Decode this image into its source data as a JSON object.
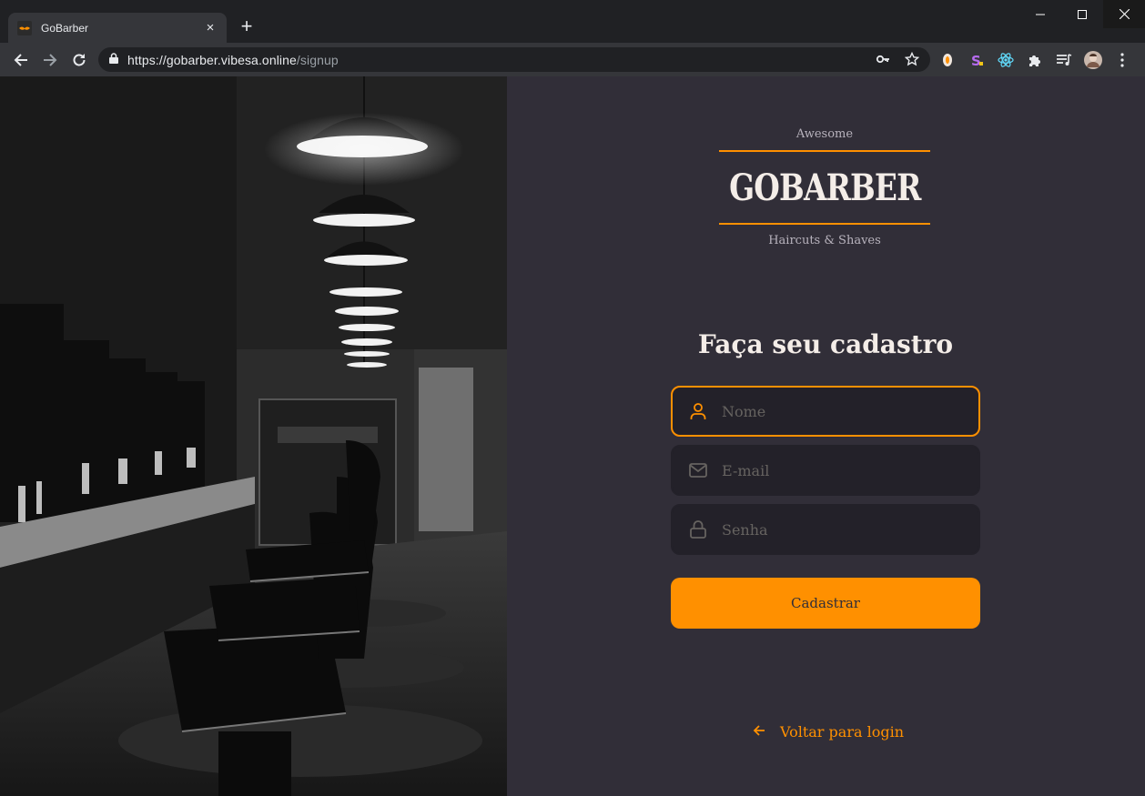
{
  "browser": {
    "tab_title": "GoBarber",
    "tab_close": "×",
    "new_tab": "+",
    "url_host": "https://gobarber.vibesa.online",
    "url_path": "/signup"
  },
  "logo": {
    "top": "Awesome",
    "main": "GOBARBER",
    "bottom": "Haircuts & Shaves"
  },
  "form": {
    "heading": "Faça seu cadastro",
    "name_placeholder": "Nome",
    "email_placeholder": "E-mail",
    "password_placeholder": "Senha",
    "submit_label": "Cadastrar"
  },
  "back_link": {
    "label": "Voltar para login"
  },
  "colors": {
    "accent": "#ff9000",
    "background": "#312e38",
    "input_bg": "#232129",
    "placeholder": "#666360",
    "text": "#f4ede8"
  },
  "icons": {
    "name": "user-icon",
    "email": "mail-icon",
    "password": "lock-icon",
    "back": "arrow-left-icon"
  }
}
